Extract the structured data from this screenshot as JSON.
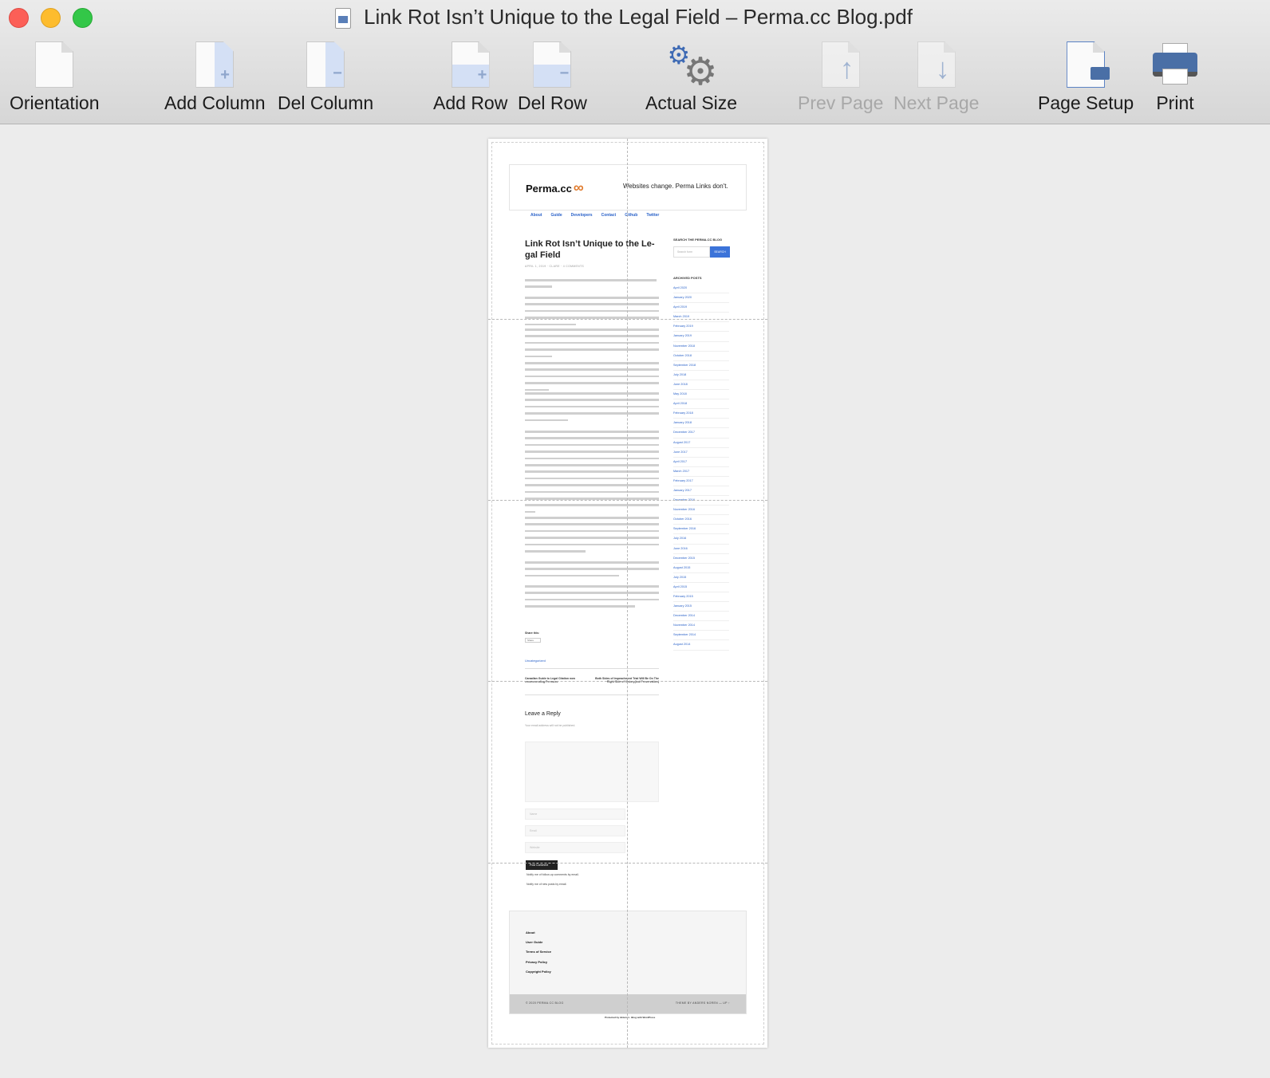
{
  "window": {
    "title": "Link Rot Isn’t Unique to the Legal Field – Perma.cc Blog.pdf"
  },
  "toolbar": {
    "orientation": "Orientation",
    "add_column": "Add Column",
    "del_column": "Del Column",
    "add_row": "Add Row",
    "del_row": "Del Row",
    "actual_size": "Actual Size",
    "prev_page": "Prev Page",
    "next_page": "Next Page",
    "page_setup": "Page Setup",
    "print": "Print"
  },
  "page": {
    "logo": "Perma.cc",
    "logo_symbol": "∞",
    "tagline": "Websites change. Perma Links don't.",
    "nav": [
      "About",
      "Guide",
      "Developers",
      "Contact",
      "Github",
      "Twitter"
    ],
    "post_title": "Link Rot Isn’t Unique to the Le-gal Field",
    "post_meta": "APRIL 1, 2019 · CLARE · 4 COMMENTS",
    "sidebar_search_title": "SEARCH THE PERMA.CC BLOG",
    "search_placeholder": "Search form",
    "search_button": "SEARCH",
    "archives_title": "ARCHIVED POSTS",
    "archives": [
      "April 2020",
      "January 2020",
      "April 2019",
      "March 2019",
      "February 2019",
      "January 2019",
      "November 2018",
      "October 2018",
      "September 2018",
      "July 2018",
      "June 2018",
      "May 2018",
      "April 2018",
      "February 2018",
      "January 2018",
      "December 2017",
      "August 2017",
      "June 2017",
      "April 2017",
      "March 2017",
      "February 2017",
      "January 2017",
      "December 2016",
      "November 2016",
      "October 2016",
      "September 2016",
      "July 2016",
      "June 2016",
      "December 2015",
      "August 2015",
      "July 2015",
      "April 2015",
      "February 2015",
      "January 2015",
      "December 2014",
      "November 2014",
      "September 2014",
      "August 2014"
    ],
    "share_label": "Share this:",
    "share_button": "Share",
    "category": "Uncategorized",
    "prev_post": "Canadian Guide to Legal Citation now recommending Perma.cc",
    "next_post": "Both Sides of Impeachment Trial Will Be On The Right Side of History(ical Preservation)",
    "reply_title": "Leave a Reply",
    "reply_note": "Your email address will not be published.",
    "field_name": "Name",
    "field_email": "Email",
    "field_website": "Website",
    "post_comment": "Post Comment",
    "notify_followup": "Notify me of follow-up comments by email.",
    "notify_new": "Notify me of new posts by email.",
    "footer_links": [
      "About",
      "User Guide",
      "Terms of Service",
      "Privacy Policy",
      "Copyright Policy"
    ],
    "footer_left": "© 2020 PERMA.CC BLOG",
    "footer_right": "THEME BY ANDERS NOREN — UP ↑",
    "powered": "Protected by Akismet · Blog with WordPress"
  }
}
